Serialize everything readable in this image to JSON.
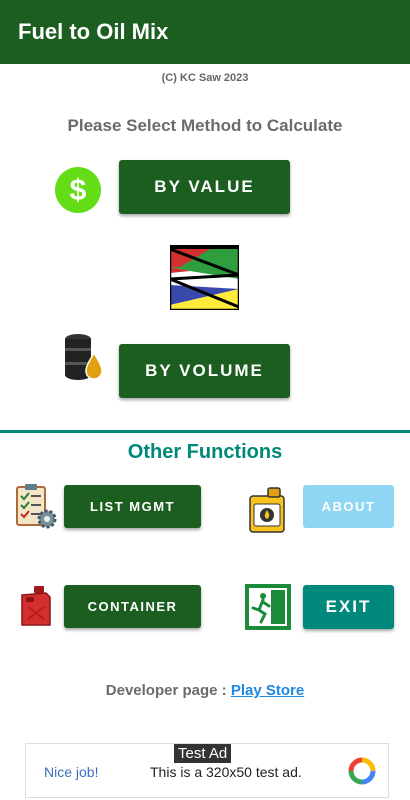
{
  "app": {
    "title": "Fuel to Oil Mix"
  },
  "copyright": "(C) KC Saw  2023",
  "main": {
    "heading": "Please Select Method to Calculate",
    "by_value_label": "BY VALUE",
    "by_volume_label": "BY VOLUME"
  },
  "other": {
    "heading": "Other Functions",
    "list_mgmt_label": "LIST MGMT",
    "about_label": "ABOUT",
    "container_label": "CONTAINER",
    "exit_label": "EXIT"
  },
  "developer": {
    "label": "Developer page :",
    "link": "Play Store"
  },
  "ad": {
    "tag": "Test Ad",
    "nice": "Nice job!",
    "message": "This is a 320x50 test ad."
  },
  "colors": {
    "primary": "#1b5e20",
    "accent": "#00897b",
    "about": "#8fd6f5",
    "link": "#1e88e5"
  },
  "icons": [
    "dollar-icon",
    "flag-logo-icon",
    "oil-barrel-icon",
    "checklist-gear-icon",
    "oil-can-icon",
    "fuel-jerrycan-icon",
    "exit-door-icon",
    "ad-logo-icon"
  ]
}
